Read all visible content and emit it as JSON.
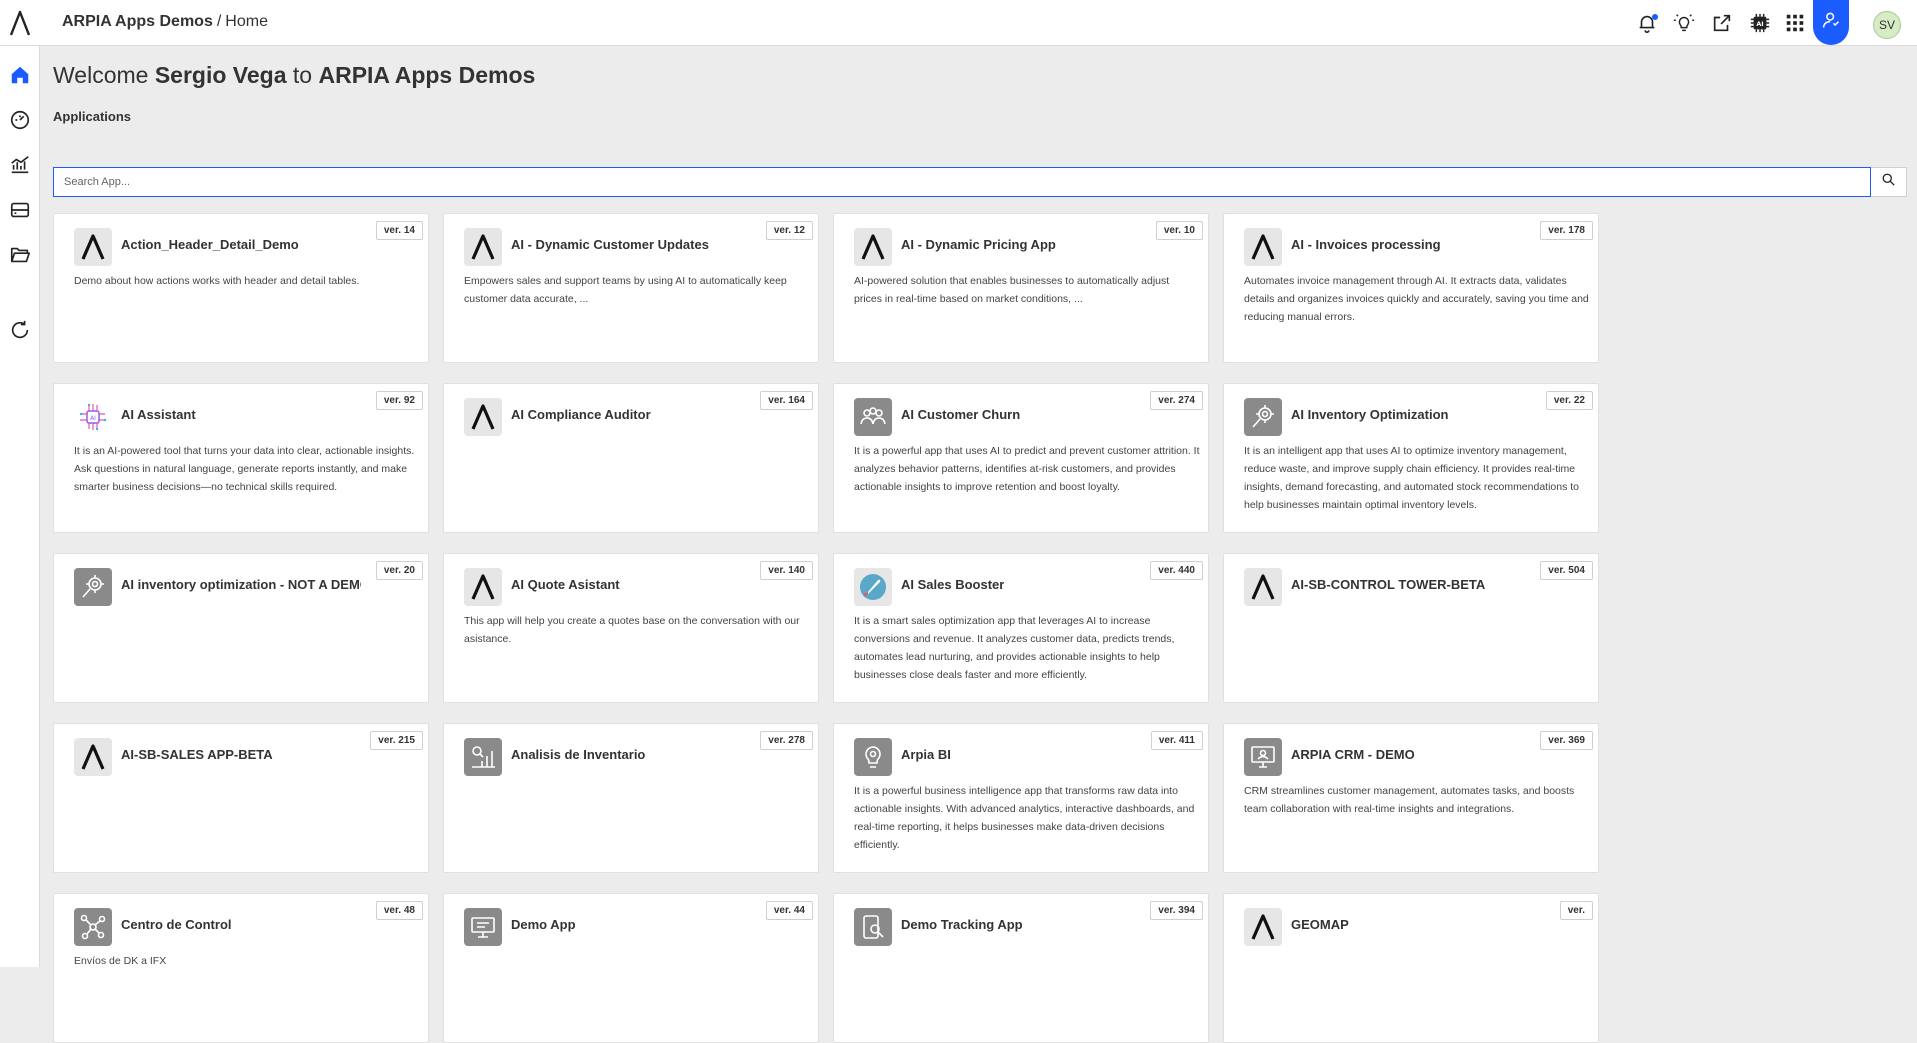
{
  "header": {
    "app_name": "ARPIA Apps Demos",
    "separator": "/",
    "page": "Home",
    "user_initials": "SV",
    "icons": [
      "bell-icon",
      "lightbulb-icon",
      "share-icon",
      "ai-chip-icon",
      "apps-grid-icon",
      "user-icon"
    ]
  },
  "sidebar": {
    "items": [
      "home-icon",
      "dashboard-gauge-icon",
      "analytics-chart-icon",
      "storage-icon",
      "folder-icon",
      "refresh-icon"
    ]
  },
  "main": {
    "welcome_prefix": "Welcome",
    "user_name": "Sergio Vega",
    "welcome_to": "to",
    "workspace": "ARPIA Apps Demos",
    "section": "Applications",
    "search_placeholder": "Search App..."
  },
  "colors": {
    "accent": "#1a5cff",
    "background": "#ececec"
  },
  "apps": [
    {
      "title": "Action_Header_Detail_Demo",
      "ver": "ver. 14",
      "icon": "arpia-logo-icon",
      "desc": "Demo about how actions works with header and detail tables."
    },
    {
      "title": "AI - Dynamic Customer Updates",
      "ver": "ver. 12",
      "icon": "arpia-logo-icon",
      "desc": "Empowers sales and support teams by using AI to automatically keep customer data accurate, ..."
    },
    {
      "title": "AI - Dynamic Pricing App",
      "ver": "ver. 10",
      "icon": "arpia-logo-icon",
      "desc": "AI-powered solution that enables businesses to automatically adjust prices in real-time based on market conditions, ..."
    },
    {
      "title": "AI - Invoices processing",
      "ver": "ver. 178",
      "icon": "arpia-logo-icon",
      "desc": "Automates invoice management through AI. It extracts data, validates details and organizes invoices quickly and accurately, saving you time and reducing manual errors."
    },
    {
      "title": "AI Assistant",
      "ver": "ver. 92",
      "icon": "ai-circuit-icon",
      "desc": "It is an AI-powered tool that turns your data into clear, actionable insights. Ask questions in natural language, generate reports instantly, and make smarter business decisions—no technical skills required."
    },
    {
      "title": "AI Compliance Auditor",
      "ver": "ver. 164",
      "icon": "arpia-logo-icon",
      "desc": ""
    },
    {
      "title": "AI Customer Churn",
      "ver": "ver. 274",
      "icon": "people-group-icon",
      "desc": "It is a powerful app that uses AI to predict and prevent customer attrition. It analyzes behavior patterns, identifies at-risk customers, and provides actionable insights to improve retention and boost loyalty."
    },
    {
      "title": "AI Inventory Optimization",
      "ver": "ver. 22",
      "icon": "gear-search-icon",
      "desc": "It is an intelligent app that uses AI to optimize inventory management, reduce waste, and improve supply chain efficiency. It provides real-time insights, demand forecasting, and automated stock recommendations to help businesses maintain optimal inventory levels."
    },
    {
      "title": "AI inventory optimization - NOT A DEMO",
      "ver": "ver. 20",
      "icon": "gear-search-icon",
      "desc": ""
    },
    {
      "title": "AI Quote Asistant",
      "ver": "ver. 140",
      "icon": "arpia-logo-icon",
      "desc": "This app will help you create a quotes base on the conversation with our asistance."
    },
    {
      "title": "AI Sales Booster",
      "ver": "ver. 440",
      "icon": "rocket-icon",
      "desc": "It is a smart sales optimization app that leverages AI to increase conversions and revenue. It analyzes customer data, predicts trends, automates lead nurturing, and provides actionable insights to help businesses close deals faster and more efficiently."
    },
    {
      "title": "AI-SB-CONTROL TOWER-BETA",
      "ver": "ver. 504",
      "icon": "arpia-logo-icon",
      "desc": ""
    },
    {
      "title": "AI-SB-SALES APP-BETA",
      "ver": "ver. 215",
      "icon": "arpia-logo-icon",
      "desc": ""
    },
    {
      "title": "Analisis de Inventario",
      "ver": "ver. 278",
      "icon": "inventory-chart-icon",
      "desc": ""
    },
    {
      "title": "Arpia BI",
      "ver": "ver. 411",
      "icon": "lightbulb-gear-icon",
      "desc": "It is a powerful business intelligence app that transforms raw data into actionable insights. With advanced analytics, interactive dashboards, and real-time reporting, it helps businesses make data-driven decisions efficiently."
    },
    {
      "title": "ARPIA CRM - DEMO",
      "ver": "ver. 369",
      "icon": "crm-monitor-icon",
      "desc": "CRM streamlines customer management, automates tasks, and boosts team collaboration with real-time insights and integrations."
    },
    {
      "title": "Centro de Control",
      "ver": "ver. 48",
      "icon": "network-icon",
      "desc": "Envíos de DK a IFX"
    },
    {
      "title": "Demo App",
      "ver": "ver. 44",
      "icon": "monitor-icon",
      "desc": ""
    },
    {
      "title": "Demo Tracking App",
      "ver": "ver. 394",
      "icon": "tracking-icon",
      "desc": ""
    },
    {
      "title": "GEOMAP",
      "ver": "ver.",
      "icon": "arpia-logo-icon",
      "desc": ""
    }
  ]
}
